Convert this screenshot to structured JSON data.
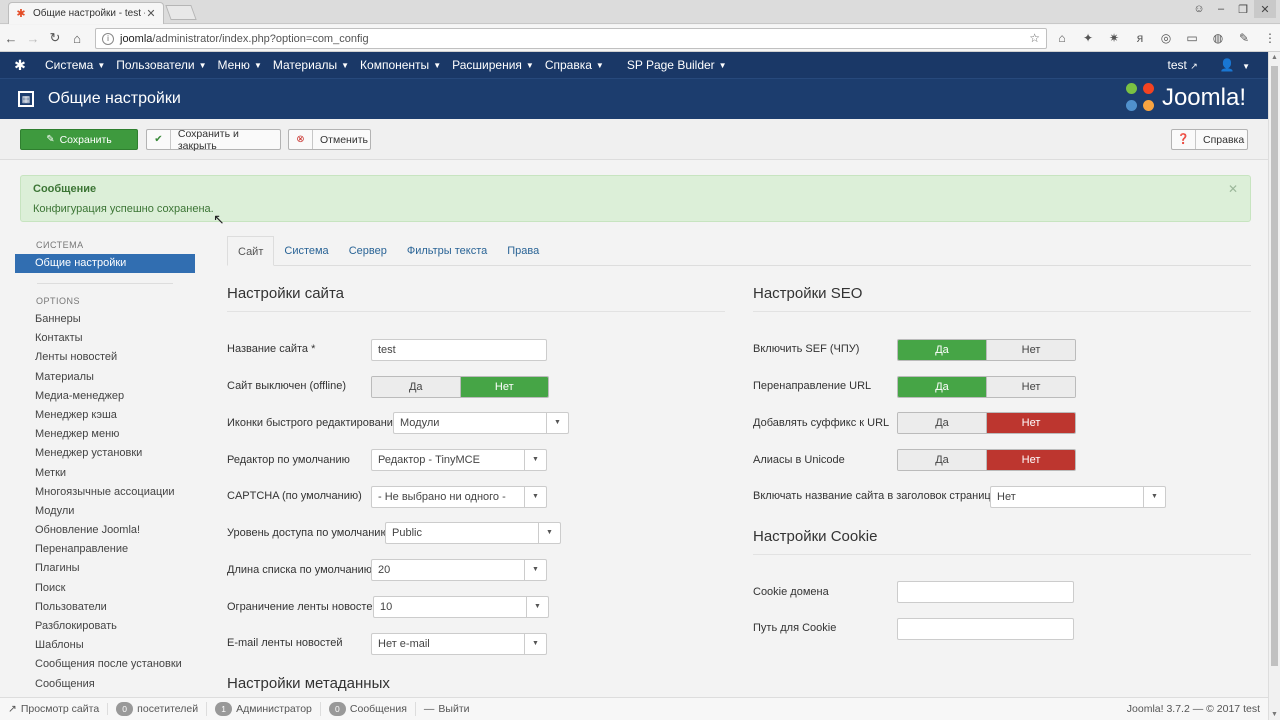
{
  "browser": {
    "tab_title": "Общие настройки - test -",
    "url_host": "joomla",
    "url_path": "/administrator/index.php?option=com_config"
  },
  "topnav": {
    "items": [
      "Система",
      "Пользователи",
      "Меню",
      "Материалы",
      "Компоненты",
      "Расширения",
      "Справка",
      "SP Page Builder"
    ],
    "user": "test"
  },
  "header": {
    "title": "Общие настройки",
    "brand": "Joomla!"
  },
  "toolbar": {
    "save": "Сохранить",
    "save_close": "Сохранить и закрыть",
    "cancel": "Отменить",
    "help": "Справка"
  },
  "alert": {
    "heading": "Сообщение",
    "message": "Конфигурация успешно сохранена."
  },
  "sidebar": {
    "system_heading": "СИСТЕМА",
    "active": "Общие настройки",
    "options_heading": "OPTIONS",
    "items": [
      "Баннеры",
      "Контакты",
      "Ленты новостей",
      "Материалы",
      "Медиа-менеджер",
      "Менеджер кэша",
      "Менеджер меню",
      "Менеджер установки",
      "Метки",
      "Многоязычные ассоциации",
      "Модули",
      "Обновление Joomla!",
      "Перенаправление",
      "Плагины",
      "Поиск",
      "Пользователи",
      "Разблокировать",
      "Шаблоны",
      "Сообщения после установки",
      "Сообщения"
    ]
  },
  "tabs": [
    "Сайт",
    "Система",
    "Сервер",
    "Фильтры текста",
    "Права"
  ],
  "site": {
    "title": "Настройки сайта",
    "site_name_label": "Название сайта *",
    "site_name_value": "test",
    "offline_label": "Сайт выключен (offline)",
    "offline_yes": "Да",
    "offline_no": "Нет",
    "frontedit_label": "Иконки быстрого редактирования",
    "frontedit_value": "Модули",
    "editor_label": "Редактор по умолчанию",
    "editor_value": "Редактор - TinyMCE",
    "captcha_label": "CAPTCHA (по умолчанию)",
    "captcha_value": "- Не выбрано ни одного -",
    "access_label": "Уровень доступа по умолчанию",
    "access_value": "Public",
    "listlimit_label": "Длина списка по умолчанию",
    "listlimit_value": "20",
    "feedlimit_label": "Ограничение ленты новостей",
    "feedlimit_value": "10",
    "feedemail_label": "E-mail ленты новостей",
    "feedemail_value": "Нет e-mail",
    "meta_title": "Настройки метаданных"
  },
  "seo": {
    "title": "Настройки SEO",
    "sef_label": "Включить SEF (ЧПУ)",
    "rewrite_label": "Перенаправление URL",
    "suffix_label": "Добавлять суффикс к URL",
    "unicode_label": "Алиасы в Unicode",
    "yes": "Да",
    "no": "Нет",
    "sitename_title_label": "Включать название сайта в заголовок страницы",
    "sitename_title_value": "Нет"
  },
  "cookie": {
    "title": "Настройки Cookie",
    "domain_label": "Cookie домена",
    "path_label": "Путь для Cookie"
  },
  "statusbar": {
    "view_site": "Просмотр сайта",
    "visitors_count": "0",
    "visitors": "посетителей",
    "admins_count": "1",
    "admins": "Администратор",
    "messages_count": "0",
    "messages": "Сообщения",
    "logout": "Выйти",
    "version": "Joomla! 3.7.2 — © 2017 test"
  },
  "colors": {
    "navbar": "#1a3867",
    "save_green": "#3e9a3e",
    "toggle_green": "#46a546",
    "toggle_red": "#bd362f",
    "sidebar_active": "#316eb1",
    "alert_bg": "#dcefd8"
  }
}
